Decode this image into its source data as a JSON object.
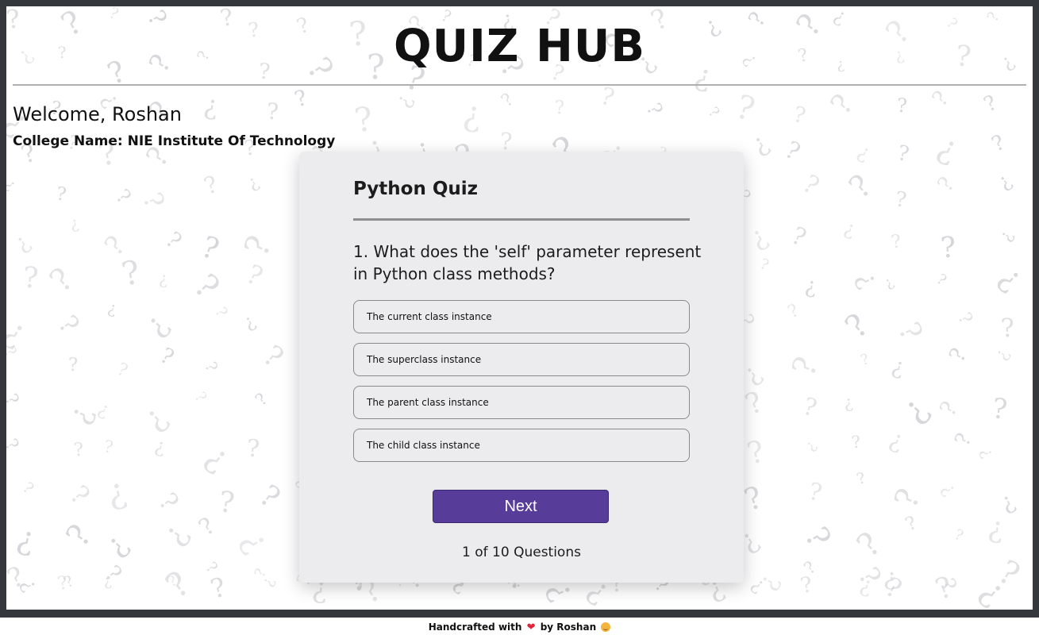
{
  "header": {
    "title": "QUIZ HUB"
  },
  "user": {
    "welcome": "Welcome, Roshan",
    "college": "College Name: NIE Institute Of Technology"
  },
  "quiz": {
    "title": "Python Quiz",
    "question": "1. What does the 'self' parameter represent in Python class methods?",
    "options": [
      "The current class instance",
      "The superclass instance",
      "The parent class instance",
      "The child class instance"
    ],
    "next_label": "Next",
    "progress": "1 of 10 Questions"
  },
  "footer": {
    "prefix": "Handcrafted with",
    "heart_icon": "heart-icon",
    "suffix": "by Roshan",
    "emoji_icon": "smiling-face-icon"
  },
  "colors": {
    "frame": "#34373c",
    "card": "#ececee",
    "accent": "#573c99",
    "heart": "#e0263b"
  }
}
